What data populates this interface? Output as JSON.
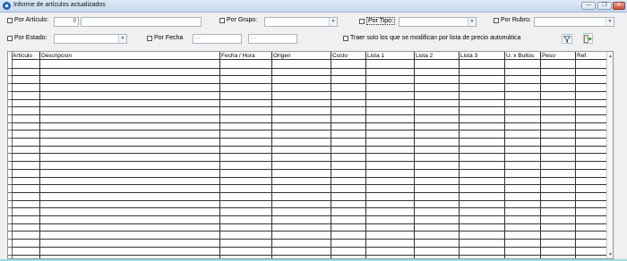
{
  "window": {
    "title": "Informe de artículos actualizados",
    "minimize": "—",
    "restore": "❐",
    "close": "✕"
  },
  "filters": {
    "por_articulo": {
      "label": "Por Artículo:",
      "value": "0"
    },
    "por_grupo": {
      "label": "Por Grupo:"
    },
    "por_tipo": {
      "label": "Por Tipo:"
    },
    "por_rubro": {
      "label": "Por Rubro:"
    },
    "por_estado": {
      "label": "Por Estado:"
    },
    "por_fecha": {
      "label": "Por Fecha",
      "desde": "- -",
      "hasta": "- -"
    },
    "traer_solo": {
      "label": "Traer solo los que se modifican por lista de precio automática"
    }
  },
  "toolbar": {
    "filter_icon": "filter-icon",
    "export_icon": "export-icon"
  },
  "table": {
    "columns": [
      "Artículo",
      "Descripcion",
      "Fecha / Hora",
      "Origen",
      "Costo",
      "Lista 1",
      "Lista 2",
      "Lista 3",
      "U. x Bultos",
      "Peso",
      "Ref."
    ],
    "rows": []
  },
  "colors": {
    "titlebar": "#c7d9ee",
    "grid_border": "#333333",
    "scroll_accent": "#9fd9df"
  }
}
